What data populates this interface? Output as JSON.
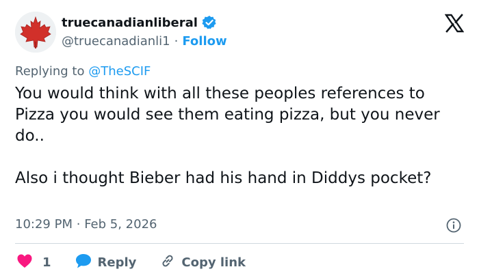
{
  "colors": {
    "accent": "#1d9bf0",
    "muted": "#536471",
    "text": "#0f1419",
    "like": "#f91880",
    "divider": "#cfd9de"
  },
  "author": {
    "display_name": "truecanadianliberal",
    "verified": true,
    "handle": "@truecanadianli1",
    "separator": "·",
    "follow_label": "Follow",
    "avatar": "maple-leaf"
  },
  "reply_context": {
    "prefix": "Replying to",
    "mention": "@TheSCIF"
  },
  "tweet": {
    "paragraph_1": "You would think with all these peoples references to Pizza you would see them eating pizza, but you never do..",
    "paragraph_2": "Also i thought Bieber had his hand in Diddys pocket?"
  },
  "meta": {
    "time": "10:29 PM",
    "separator": "·",
    "date": "Feb 5, 2026"
  },
  "actions": {
    "like_count": "1",
    "reply_label": "Reply",
    "copy_link_label": "Copy link"
  },
  "icons": {
    "verified": "verified-badge-icon",
    "logo": "x-logo-icon",
    "info": "info-icon",
    "like": "heart-icon",
    "reply": "speech-bubble-icon",
    "copy": "link-icon"
  }
}
